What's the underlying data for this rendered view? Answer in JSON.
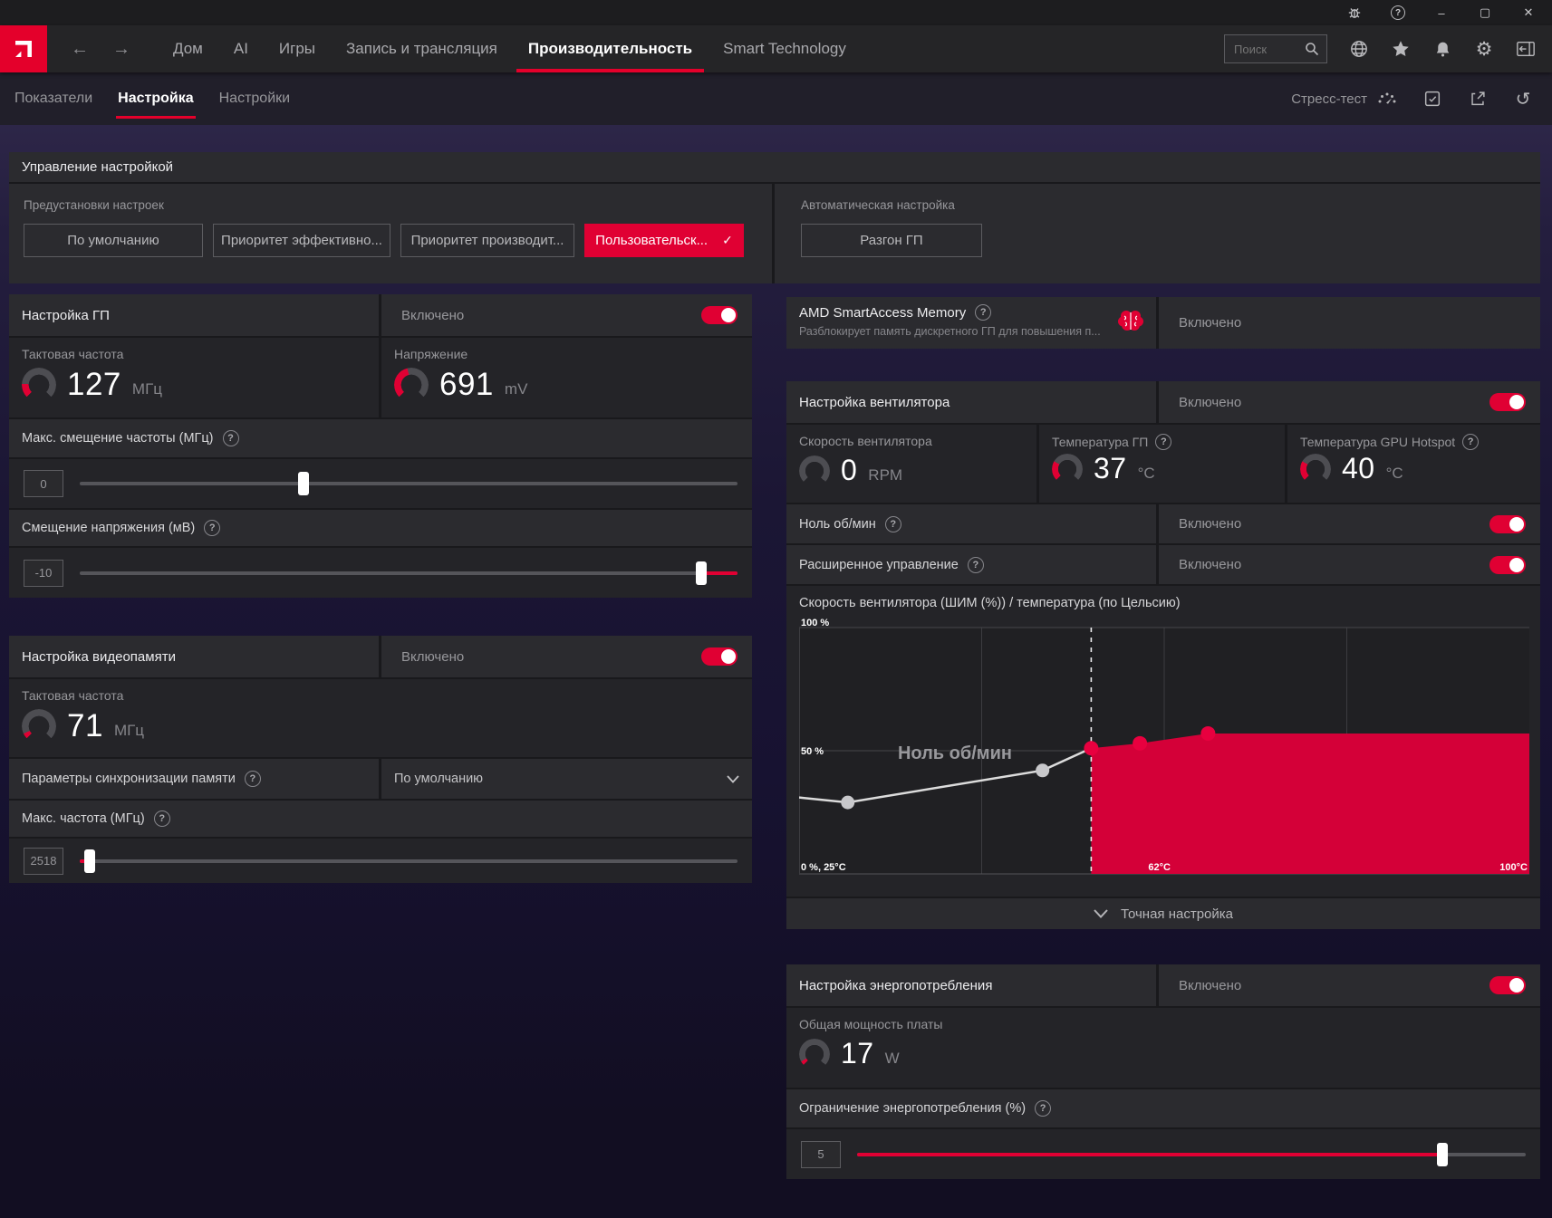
{
  "colors": {
    "accent": "#e00033",
    "logo_red": "#e4002b",
    "chart_area": "#d40038"
  },
  "titlebar": {
    "minimize": "–",
    "maximize": "▢",
    "close": "✕",
    "help": "?"
  },
  "navbar": {
    "tabs": [
      {
        "label": "Дом"
      },
      {
        "label": "AI"
      },
      {
        "label": "Игры"
      },
      {
        "label": "Запись и трансляция"
      },
      {
        "label": "Производительность"
      },
      {
        "label": "Smart Technology"
      }
    ],
    "active_tab": "Производительность",
    "search_placeholder": "Поиск"
  },
  "subnav": {
    "tabs": [
      {
        "label": "Показатели"
      },
      {
        "label": "Настройка"
      },
      {
        "label": "Настройки"
      }
    ],
    "active_tab": "Настройка",
    "stress_test_label": "Стресс-тест"
  },
  "tuning_control": {
    "title": "Управление настройкой",
    "presets_label": "Предустановки настроек",
    "presets": [
      {
        "label": "По умолчанию"
      },
      {
        "label": "Приоритет эффективно..."
      },
      {
        "label": "Приоритет производит..."
      },
      {
        "label": "Пользовательск...",
        "selected": true,
        "check": "✓"
      }
    ],
    "auto_label": "Автоматическая настройка",
    "auto_button": "Разгон ГП"
  },
  "gpu_tuning": {
    "title": "Настройка ГП",
    "status": "Включено",
    "clock": {
      "label": "Тактовая частота",
      "value": "127",
      "unit": "МГц",
      "arc_pct": 18
    },
    "voltage": {
      "label": "Напряжение",
      "value": "691",
      "unit": "mV",
      "arc_pct": 45
    },
    "freq_offset": {
      "label": "Макс. смещение частоты (МГц)",
      "value": "0",
      "pos_pct": 34
    },
    "volt_offset": {
      "label": "Смещение напряжения (мВ)",
      "value": "-10",
      "pos_pct": 94.5
    }
  },
  "vram_tuning": {
    "title": "Настройка видеопамяти",
    "status": "Включено",
    "clock": {
      "label": "Тактовая частота",
      "value": "71",
      "unit": "МГц",
      "arc_pct": 7
    },
    "memory_timing": {
      "label": "Параметры синхронизации памяти",
      "value": "По умолчанию"
    },
    "max_freq": {
      "label": "Макс. частота (МГц)",
      "value": "2518",
      "pos_pct": 1.5
    }
  },
  "sam": {
    "title": "AMD SmartAccess Memory",
    "subtitle": "Разблокирует память дискретного ГП для повышения п...",
    "status": "Включено"
  },
  "fan_tuning": {
    "title": "Настройка вентилятора",
    "status": "Включено",
    "fan_speed": {
      "label": "Скорость вентилятора",
      "value": "0",
      "unit": "RPM",
      "arc_pct": 0
    },
    "gpu_temp": {
      "label": "Температура ГП",
      "value": "37",
      "unit": "°C",
      "arc_pct": 28
    },
    "hotspot_temp": {
      "label": "Температура GPU Hotspot",
      "value": "40",
      "unit": "°C",
      "arc_pct": 28
    },
    "zero_rpm": {
      "label": "Ноль об/мин",
      "status": "Включено"
    },
    "advanced": {
      "label": "Расширенное управление",
      "status": "Включено"
    },
    "fine_tuning_label": "Точная настройка"
  },
  "chart_data": {
    "type": "area",
    "title": "Скорость вентилятора (ШИМ (%)) / температура (по Цельсию)",
    "xlabel": "температура (по Цельсию)",
    "ylabel": "Скорость вентилятора (ШИМ (%))",
    "x_range_c": [
      25,
      100
    ],
    "y_range_pct": [
      0,
      100
    ],
    "y_tick_top": "100 %",
    "y_tick_mid": "50 %",
    "x_label_left": "0 %, 25°C",
    "x_label_threshold": "62°C",
    "x_label_right": "100°C",
    "zero_rpm_label": "Ноль об/мин",
    "edge_start": {
      "t": 25,
      "pwm": 31
    },
    "curve_points": [
      {
        "t": 30,
        "pwm": 29,
        "active": false
      },
      {
        "t": 50,
        "pwm": 42,
        "active": false
      },
      {
        "t": 55,
        "pwm": 51,
        "active": true
      },
      {
        "t": 60,
        "pwm": 53,
        "active": true
      },
      {
        "t": 67,
        "pwm": 57,
        "active": true
      }
    ],
    "flat_to_right_pwm": 57,
    "area_start_t": 55,
    "threshold_label_t": 62,
    "grid": true,
    "legend": "none"
  },
  "power_tuning": {
    "title": "Настройка энергопотребления",
    "status": "Включено",
    "board_power": {
      "label": "Общая мощность платы",
      "value": "17",
      "unit": "W",
      "arc_pct": 6
    },
    "power_limit": {
      "label": "Ограничение энергопотребления (%)",
      "value": "5",
      "pos_pct": 87.5
    }
  }
}
